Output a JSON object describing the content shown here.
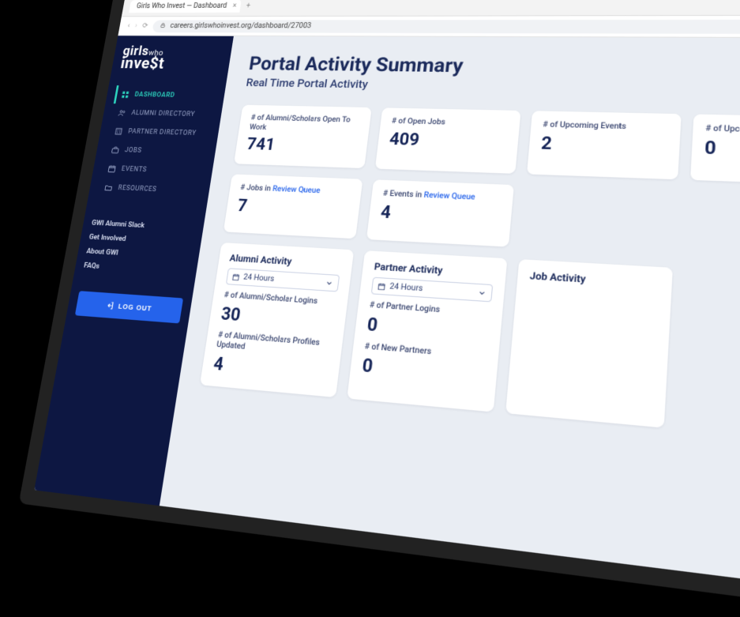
{
  "browser": {
    "tab_title": "Girls Who Invest — Dashboard",
    "url": "careers.girlswhoinvest.org/dashboard/27003"
  },
  "logo": {
    "line1_a": "girls",
    "line1_b": "who",
    "line2": "inve$t"
  },
  "sidebar": {
    "items": [
      {
        "label": "DASHBOARD",
        "active": true
      },
      {
        "label": "ALUMNI DIRECTORY"
      },
      {
        "label": "PARTNER DIRECTORY"
      },
      {
        "label": "JOBS"
      },
      {
        "label": "EVENTS"
      },
      {
        "label": "RESOURCES"
      }
    ],
    "links": [
      "GWI Alumni Slack",
      "Get Involved",
      "About GWI",
      "FAQs"
    ],
    "logout": "LOG OUT"
  },
  "header": {
    "title": "Portal Activity Summary",
    "subtitle": "Real Time Portal Activity"
  },
  "cards": {
    "open_to_work": {
      "label": "# of Alumni/Scholars Open To Work",
      "value": "741"
    },
    "open_jobs": {
      "label": "# of Open Jobs",
      "value": "409"
    },
    "review_jobs": {
      "label_pre": "# Jobs in ",
      "label_link": "Review Queue",
      "value": "7"
    },
    "upcoming_events": {
      "label": "# of Upcoming Events",
      "value": "2"
    },
    "review_events": {
      "label_pre": "# Events in ",
      "label_link": "Review Queue",
      "value": "4"
    },
    "upcoming_partner_events": {
      "label": "# of Upcoming Partner Events",
      "value": "0"
    }
  },
  "alumni_activity": {
    "title": "Alumni Activity",
    "select": "24 Hours",
    "logins": {
      "label": "# of Alumni/Scholar Logins",
      "value": "30"
    },
    "profiles": {
      "label": "# of Alumni/Scholars Profiles Updated",
      "value": "4"
    }
  },
  "partner_activity": {
    "title": "Partner Activity",
    "select": "24 Hours",
    "logins": {
      "label": "# of Partner Logins",
      "value": "0"
    },
    "new_partners": {
      "label": "# of New Partners",
      "value": "0"
    }
  },
  "job_activity": {
    "title": "Job Activity"
  },
  "help_icon": "⊙"
}
